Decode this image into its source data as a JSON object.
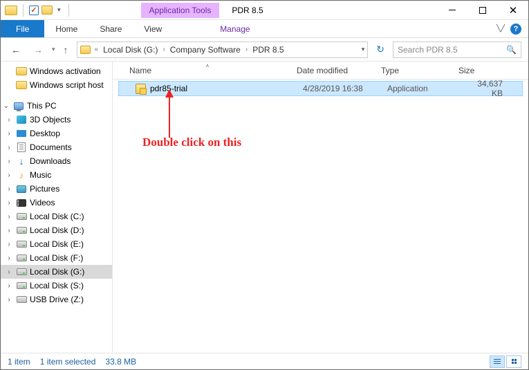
{
  "titlebar": {
    "contextTab": "Application Tools",
    "title": "PDR 8.5"
  },
  "ribbon": {
    "file": "File",
    "home": "Home",
    "share": "Share",
    "view": "View",
    "manage": "Manage"
  },
  "address": {
    "crumbs": [
      "Local Disk (G:)",
      "Company Software",
      "PDR 8.5"
    ],
    "searchPlaceholder": "Search PDR 8.5"
  },
  "navpane": {
    "quick": [
      {
        "label": "Windows activation"
      },
      {
        "label": "Windows script host"
      }
    ],
    "pcLabel": "This PC",
    "pcItems": [
      {
        "label": "3D Objects",
        "ico": "ico-3d"
      },
      {
        "label": "Desktop",
        "ico": "ico-desktop"
      },
      {
        "label": "Documents",
        "ico": "ico-docs"
      },
      {
        "label": "Downloads",
        "ico": "ico-dl",
        "glyph": "↓"
      },
      {
        "label": "Music",
        "ico": "ico-music",
        "glyph": "♪"
      },
      {
        "label": "Pictures",
        "ico": "ico-pics"
      },
      {
        "label": "Videos",
        "ico": "ico-video"
      },
      {
        "label": "Local Disk (C:)",
        "ico": "ico-drive"
      },
      {
        "label": "Local Disk (D:)",
        "ico": "ico-drive"
      },
      {
        "label": "Local Disk (E:)",
        "ico": "ico-drive"
      },
      {
        "label": "Local Disk (F:)",
        "ico": "ico-drive"
      },
      {
        "label": "Local Disk (G:)",
        "ico": "ico-drive",
        "selected": true
      },
      {
        "label": "Local Disk (S:)",
        "ico": "ico-drive"
      },
      {
        "label": "USB Drive (Z:)",
        "ico": "ico-usb"
      }
    ]
  },
  "columns": {
    "name": "Name",
    "date": "Date modified",
    "type": "Type",
    "size": "Size"
  },
  "files": [
    {
      "name": "pdr85-trial",
      "date": "4/28/2019 16:38",
      "type": "Application",
      "size": "34,637 KB",
      "selected": true
    }
  ],
  "annotation": "Double click on this",
  "status": {
    "count": "1 item",
    "selected": "1 item selected",
    "size": "33.8 MB"
  }
}
